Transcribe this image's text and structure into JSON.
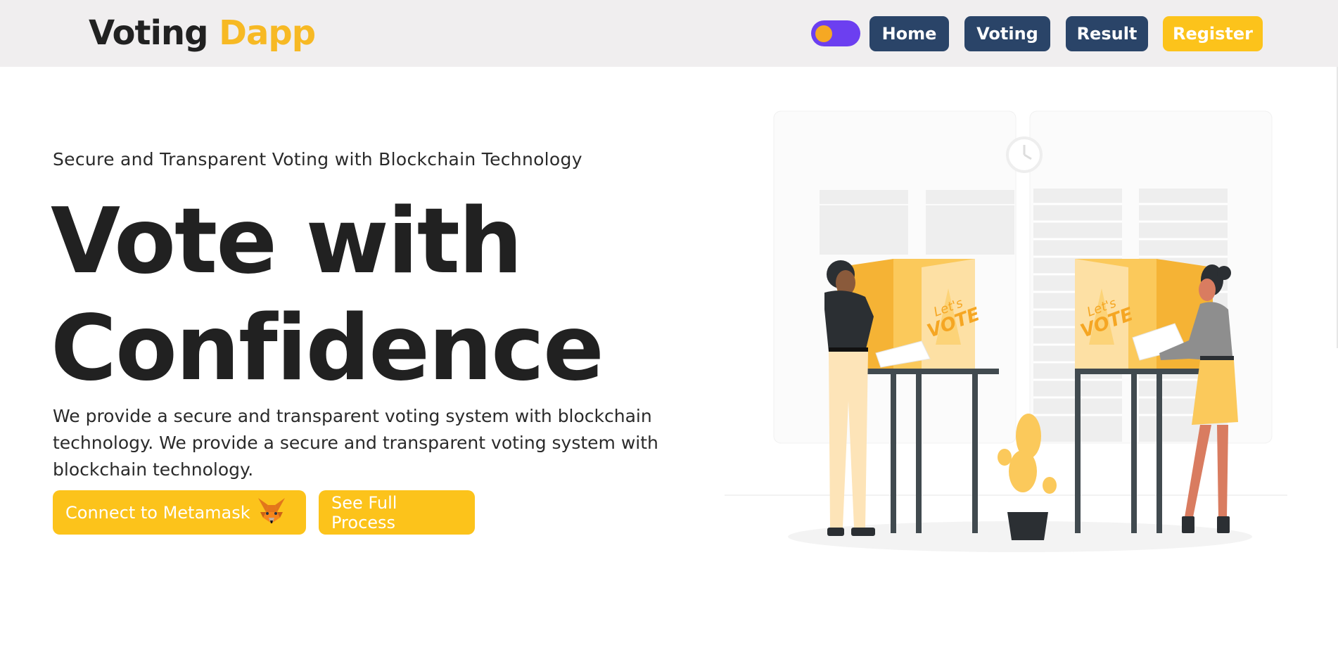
{
  "nav": {
    "brand_primary": "Voting",
    "brand_accent": "Dapp",
    "theme_toggle": "theme-toggle",
    "links": [
      {
        "label": "Home"
      },
      {
        "label": "Voting"
      },
      {
        "label": "Result"
      },
      {
        "label": "Register"
      }
    ]
  },
  "hero": {
    "subtitle": "Secure and Transparent Voting with Blockchain Technology",
    "title_line1": "Vote with",
    "title_line2": "Confidence",
    "description": "We provide a secure and transparent voting system with blockchain technology. We provide a secure and transparent voting system with blockchain technology.",
    "buttons": {
      "connect": "Connect to Metamask",
      "process": "See Full Process"
    }
  },
  "illustration": {
    "booth_text_1": "Let's",
    "booth_text_2": "VOTE",
    "icons": [
      "fox-icon",
      "voting-booth-illustration"
    ]
  },
  "colors": {
    "accent": "#fcc31b",
    "nav_button": "#2a4468",
    "toggle": "#6c3ff0",
    "navbar_bg": "#f0eeef"
  }
}
